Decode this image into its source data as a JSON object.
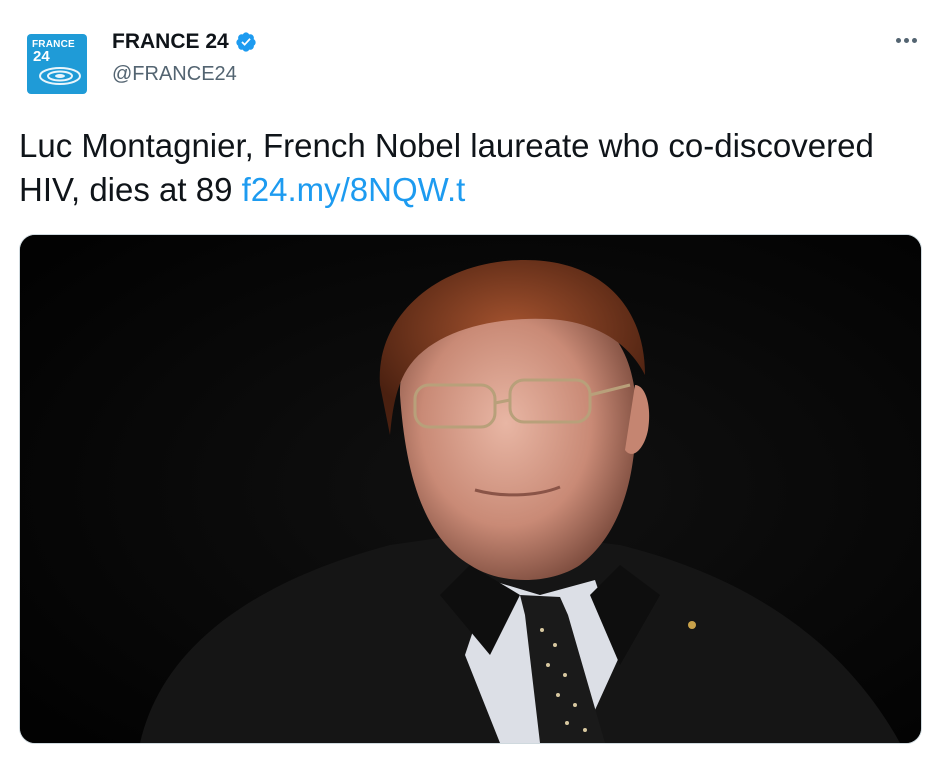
{
  "author": {
    "display_name": "FRANCE 24",
    "handle": "@FRANCE24",
    "verified": true,
    "avatar_logo_line1": "FRANCE",
    "avatar_logo_line2": "24"
  },
  "tweet": {
    "text": "Luc Montagnier, French Nobel laureate who co-discovered HIV, dies at 89 ",
    "link": "f24.my/8NQW.t"
  },
  "icons": {
    "verified": "verified-badge-icon",
    "more": "more-options-icon"
  },
  "colors": {
    "link": "#1d9bf0",
    "verified": "#1d9bf0",
    "avatar_bg": "#1f9bd7",
    "secondary_text": "#536471"
  }
}
